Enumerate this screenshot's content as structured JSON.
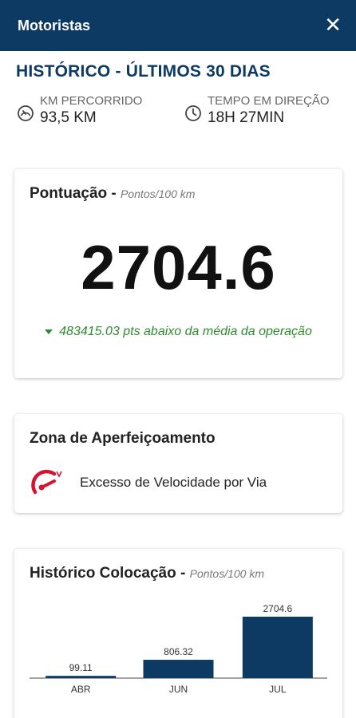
{
  "header": {
    "title": "Motoristas",
    "close_icon": "close-icon"
  },
  "history": {
    "title": "HISTÓRICO - ÚLTIMOS 30 DIAS",
    "km": {
      "label": "KM PERCORRIDO",
      "value": "93,5 KM",
      "icon": "speedometer-icon"
    },
    "time": {
      "label": "TEMPO EM DIREÇÃO",
      "value": "18H 27MIN",
      "icon": "clock-icon"
    }
  },
  "score_card": {
    "title": "Pontuação -",
    "unit": "Pontos/100 km",
    "value": "2704.6",
    "comparison": "483415.03 pts abaixo da média da operação",
    "comparison_color": "#2e8b2e"
  },
  "zone_card": {
    "title": "Zona de Aperfeiçoamento",
    "items": [
      {
        "label": "Excesso de Velocidade por Via",
        "icon": "speed-gauge-icon",
        "icon_color": "#d8122f"
      }
    ]
  },
  "history_card": {
    "title": "Histórico Colocação -",
    "unit": "Pontos/100 km"
  },
  "chart_data": {
    "type": "bar",
    "categories": [
      "ABR",
      "JUN",
      "JUL"
    ],
    "values": [
      99.11,
      806.32,
      2704.6
    ],
    "value_labels": [
      "99.11",
      "806.32",
      "2704.6"
    ],
    "title": "Histórico Colocação",
    "ylabel": "Pontos/100 km",
    "ylim": [
      0,
      2704.6
    ],
    "grid": false,
    "bar_color": "#0d3a63"
  },
  "colors": {
    "primary": "#0d3a63",
    "positive": "#2e8b2e",
    "alert": "#d8122f"
  }
}
